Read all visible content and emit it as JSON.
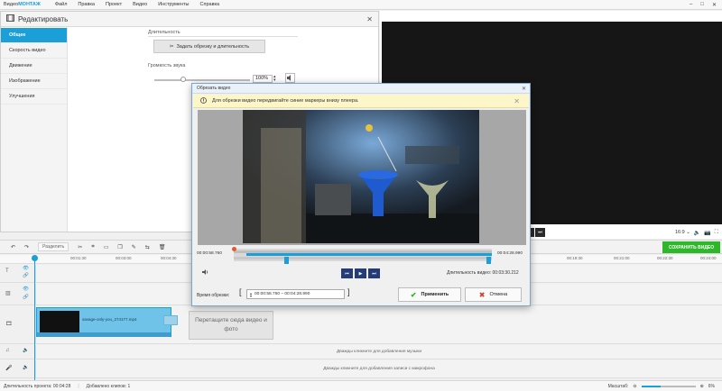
{
  "app": {
    "brand_prefix": "Видео",
    "brand_name": "МОНТАЖ",
    "menu": [
      "Файл",
      "Правка",
      "Проект",
      "Видео",
      "Инструменты",
      "Справка"
    ],
    "window_controls": [
      "–",
      "□",
      "✕"
    ]
  },
  "edit_panel": {
    "title": "Редактировать",
    "close": "✕",
    "nav": [
      "Общее",
      "Скорость видео",
      "Движение",
      "Изображение",
      "Улучшения"
    ],
    "duration_label": "Длительность",
    "trim_button": "Задать обрезку и длительность",
    "volume_label": "Громкость звука",
    "volume_value": "100%",
    "volume_level": 0.3
  },
  "preview": {
    "ratio": "16:9",
    "controls": [
      "▶",
      "⏭"
    ],
    "chevron": "⌄"
  },
  "timeline": {
    "save_button": "СОХРАНИТЬ ВИДЕО",
    "split_label": "Разделить",
    "ticks": [
      "00:01:30",
      "00:03:00",
      "00:04:30",
      "00:19:30",
      "00:21:00",
      "00:22:30",
      "00:24:00"
    ],
    "clip_name": "savage-only-you_274177.mp4",
    "drop_hint": "Перетащите сюда видео и фото",
    "music_hint": "Дважды кликните для добавления музыки",
    "mic_hint": "Дважды кликните для добавления записи с микрофона"
  },
  "status": {
    "duration_label": "Длительность проекта:",
    "duration_value": "00:04:28",
    "clips_label": "Добавлено клипов:",
    "clips_value": "1",
    "scale_label": "Масштаб:",
    "zoom_value": "6%",
    "zoom_level": 0.35
  },
  "trim_dialog": {
    "title": "Обрезать видео",
    "close": "✕",
    "warning": "Для обрезки видео передвигайте синие маркеры внизу плеера.",
    "time_start": "00:00:58.760",
    "time_end": "00:04:28.990",
    "duration_label": "Длительность видео:",
    "duration_value": "00:03:30.212",
    "trim_label": "Время обрезки:",
    "trim_range": "00:00:58.760 – 00:04:28.990",
    "apply": "Применить",
    "cancel": "Отмена"
  },
  "colors": {
    "accent": "#1a9fd9",
    "save": "#2eb72a",
    "dialog_buttons": "#253d77",
    "warning_bg": "#fdf6c8"
  }
}
